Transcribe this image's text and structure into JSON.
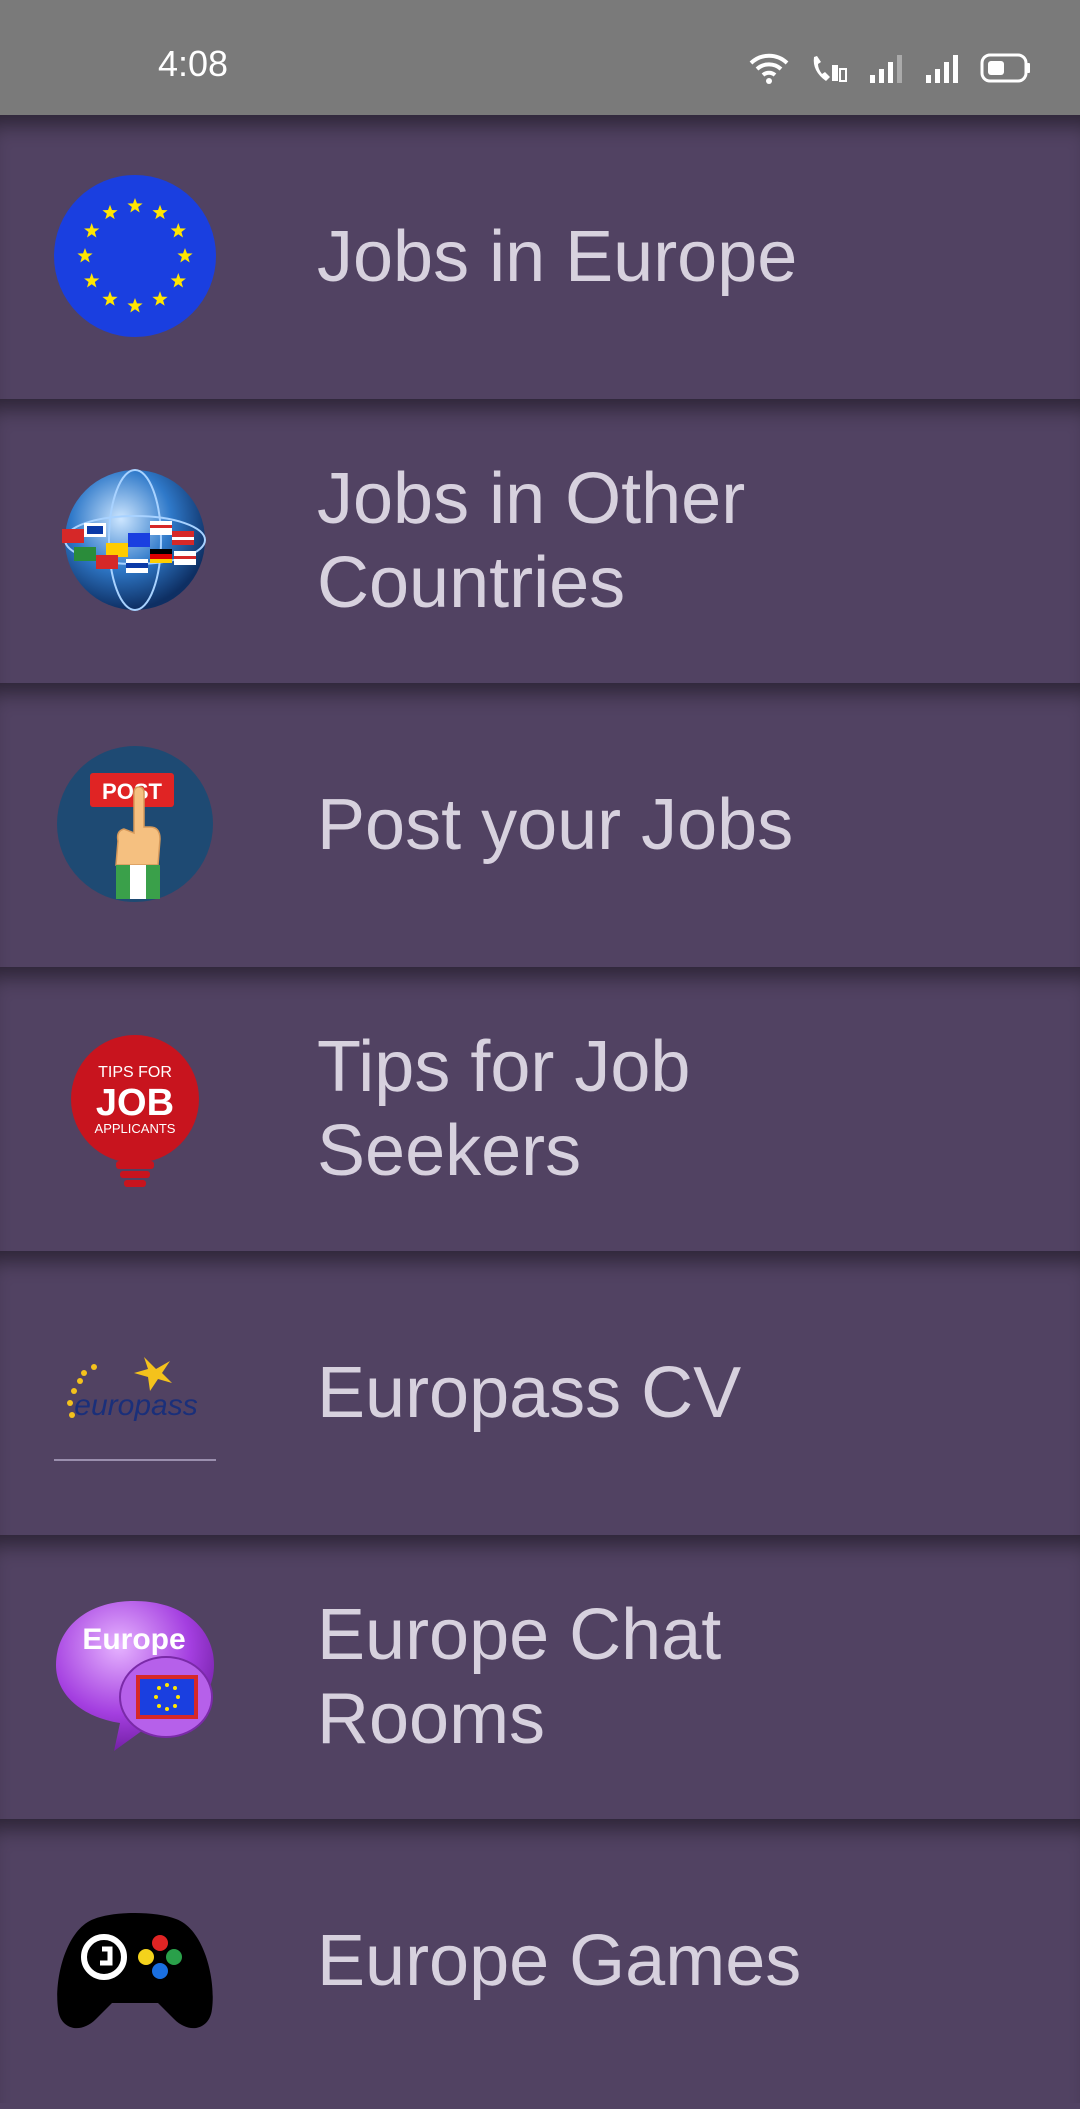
{
  "status_bar": {
    "time": "4:08",
    "icons": [
      "wifi-icon",
      "wifi-call-icon",
      "signal-icon",
      "signal-icon",
      "battery-icon"
    ]
  },
  "colors": {
    "status_bar_bg": "#7a7a7a",
    "item_bg": "#514262",
    "item_text": "#d7d1de"
  },
  "menu": {
    "items": [
      {
        "label": "Jobs in Europe",
        "icon": "eu-flag-icon"
      },
      {
        "label": "Jobs in Other Countries",
        "icon": "globe-flags-icon"
      },
      {
        "label": "Post your Jobs",
        "icon": "post-hand-icon"
      },
      {
        "label": "Tips for Job Seekers",
        "icon": "tips-job-bulb-icon",
        "icon_text": {
          "line1": "TIPS FOR",
          "line2": "JOB",
          "line3": "APPLICANTS"
        }
      },
      {
        "label": "Europass CV",
        "icon": "europass-logo-icon",
        "icon_text": "europass"
      },
      {
        "label": "Europe Chat Rooms",
        "icon": "chat-bubble-icon",
        "icon_text": "Europe"
      },
      {
        "label": "Europe Games",
        "icon": "gamepad-icon"
      }
    ]
  }
}
